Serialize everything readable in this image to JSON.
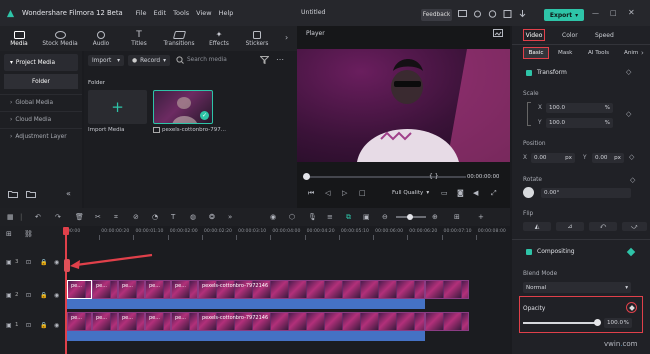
{
  "titlebar": {
    "app_name": "Wondershare Filmora 12 Beta",
    "menus": [
      "File",
      "Edit",
      "Tools",
      "View",
      "Help"
    ],
    "project_title": "Untitled",
    "feedback_label": "Feedback",
    "export_label": "Export"
  },
  "media_tabs": [
    "Media",
    "Stock Media",
    "Audio",
    "Titles",
    "Transitions",
    "Effects",
    "Stickers"
  ],
  "left_panel": {
    "project_media": "Project Media",
    "folder": "Folder",
    "items": [
      "Global Media",
      "Cloud Media",
      "Adjustment Layer"
    ]
  },
  "media_area": {
    "import_dropdown": "Import",
    "record_dropdown": "Record",
    "search_placeholder": "Search media",
    "folder_label": "Folder",
    "import_media_label": "Import Media",
    "clip_name": "pexels-cottonbro-797..."
  },
  "player": {
    "label": "Player",
    "time_current": "00:00:00:00",
    "time_brackets": "{  }",
    "quality": "Full Quality"
  },
  "right_panel": {
    "tabs": [
      "Video",
      "Color",
      "Speed"
    ],
    "subtabs": [
      "Basic",
      "Mask",
      "AI Tools",
      "Anim"
    ],
    "transform": "Transform",
    "scale": "Scale",
    "scale_x": "100.0",
    "scale_y": "100.0",
    "percent": "%",
    "position": "Position",
    "pos_x": "0.00",
    "pos_y": "0.00",
    "px": "px",
    "rotate": "Rotate",
    "rotate_value": "0.00°",
    "flip": "Flip",
    "compositing": "Compositing",
    "blend_mode": "Blend Mode",
    "blend_value": "Normal",
    "opacity": "Opacity",
    "opacity_value": "100.0",
    "opacity_level": 1.0
  },
  "timeline": {
    "ruler": [
      "00:00",
      "00:00:00:20",
      "00:00:01:10",
      "00:00:02:00",
      "00:00:02:20",
      "00:00:03:10",
      "00:00:04:00",
      "00:00:04:20",
      "00:00:05:10",
      "00:00:06:00",
      "00:00:06:20",
      "00:00:07:10",
      "00:00:08:00"
    ],
    "track_labels": [
      "3",
      "2",
      "1"
    ],
    "clip_label_full": "pexels-cottonbro-7972146",
    "clip_label_short": "pe...",
    "clip_label_first": "pe..."
  },
  "colors": {
    "accent": "#2ec4a8",
    "highlight": "#e0404a",
    "clip": "#6a2a67",
    "audio": "#4572c4"
  }
}
